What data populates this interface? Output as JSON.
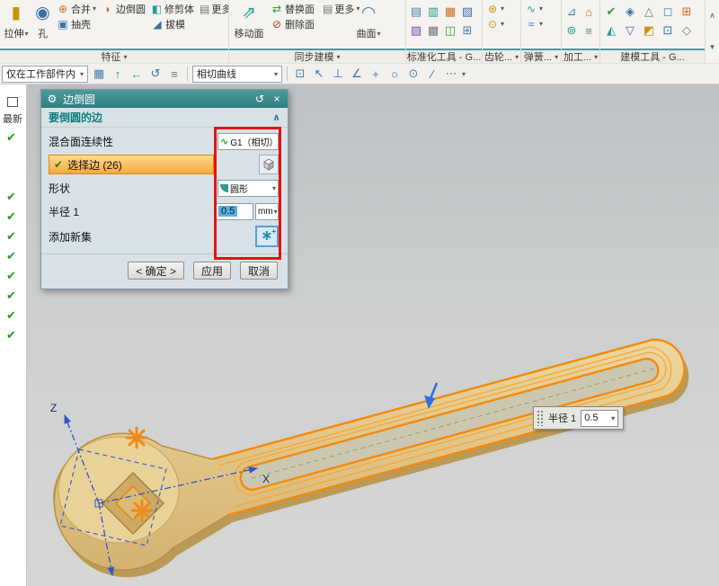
{
  "glyphs": {
    "dropdown": "▾",
    "up_chevron": "∧",
    "close": "×",
    "reset": "↺",
    "gear": "⚙",
    "check": "✔",
    "extrude": "▮",
    "hole": "◉",
    "unite": "⊕",
    "shell": "▣",
    "edge_blend": "◗",
    "trim_body": "◧",
    "draft": "◢",
    "more": "▤",
    "move_face": "⇗",
    "replace_face": "⇄",
    "delete_face": "⊘",
    "surface": "◠",
    "std1": "▤",
    "std2": "▥",
    "std3": "▦",
    "std4": "▧",
    "std5": "▨",
    "std6": "▩",
    "std7": "◫",
    "std8": "⊞",
    "gear1": "⊛",
    "gear2": "⊙",
    "spring1": "∿",
    "spring2": "≈",
    "mach1": "⊿",
    "mach2": "⌂",
    "mach3": "⊚",
    "mach4": "≡",
    "mod1": "✔",
    "mod2": "◈",
    "mod3": "△",
    "mod4": "◻",
    "mod5": "⊞",
    "mod6": "◭",
    "mod7": "▽",
    "mod8": "◩",
    "mod9": "⊡",
    "mod10": "◇",
    "t2_1": "▦",
    "t2_2": "↑",
    "t2_3": "←",
    "t2_4": "↺",
    "t2_5": "≡",
    "sn1": "⊡",
    "sn2": "↖",
    "sn3": "⊥",
    "sn4": "∠",
    "sn5": "+",
    "sn6": "○",
    "sn7": "⊙",
    "sn8": "∕",
    "sn9": "⋯",
    "sparkle": "∗",
    "plus": "+",
    "g1_curve": "∿"
  },
  "ribbon": {
    "feature": {
      "label": "特征",
      "extrude": "拉伸",
      "hole": "孔",
      "unite": "合并",
      "shell": "抽壳",
      "edge_blend": "边倒圆",
      "trim_body": "修剪体",
      "draft": "拔模",
      "more": "更多"
    },
    "sync": {
      "label": "同步建模",
      "move_face": "移动面",
      "replace_face": "替换面",
      "delete_face": "删除面",
      "more": "更多",
      "surface": "曲面"
    },
    "std_tools": {
      "label": "标准化工具 - G..."
    },
    "gear_tools": {
      "label": "齿轮..."
    },
    "spring_tools": {
      "label": "弹簧..."
    },
    "machining": {
      "label": "加工..."
    },
    "modeling_tools": {
      "label": "建模工具 - G..."
    }
  },
  "toolbar2": {
    "scope": "仅在工作部件内",
    "curve_rule": "相切曲线"
  },
  "sidebar": {
    "latest": "最新"
  },
  "dialog": {
    "title": "边倒圆",
    "section_edge": "要倒圆的边",
    "continuity_label": "混合面连续性",
    "continuity_value": "G1（相切）",
    "select_edge": "选择边 (26)",
    "shape_label": "形状",
    "shape_value": "圆形",
    "radius_label": "半径 1",
    "radius_value": "0.5",
    "unit": "mm",
    "add_set_label": "添加新集",
    "ok": "< 确定 >",
    "apply": "应用",
    "cancel": "取消"
  },
  "viewport": {
    "radius_tag_label": "半径 1",
    "radius_tag_value": "0.5",
    "axis_z": "Z",
    "axis_x": "X"
  },
  "colors": {
    "accent_teal": "#2e7f7f",
    "highlight_orange": "#f6a93c",
    "edge_orange": "#f28a0e",
    "annotation_red": "#e21313"
  }
}
